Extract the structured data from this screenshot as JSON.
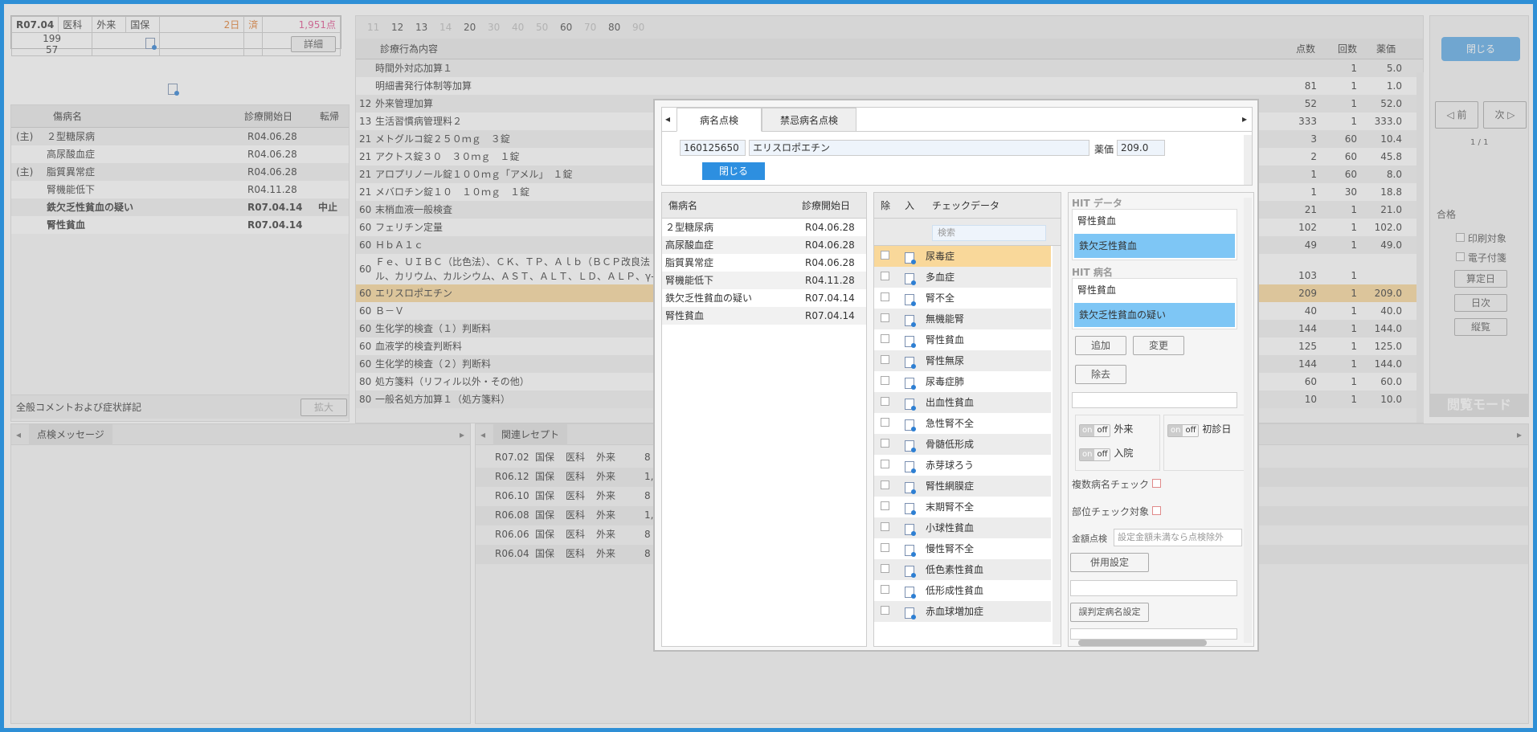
{
  "header": {
    "period": "R07.04",
    "dept": "医科",
    "visit": "外来",
    "insurer": "国保",
    "days": "2日",
    "done": "済",
    "points": "1,951点",
    "num1": "199",
    "num2": "57",
    "detail_btn": "詳細",
    "close_btn": "閉じる"
  },
  "diseases_left": {
    "col_name": "傷病名",
    "col_start": "診療開始日",
    "col_outcome": "転帰",
    "rows": [
      {
        "main": "(主)",
        "name": "２型糖尿病",
        "date": "R04.06.28",
        "outcome": ""
      },
      {
        "main": "",
        "name": "高尿酸血症",
        "date": "R04.06.28",
        "outcome": ""
      },
      {
        "main": "(主)",
        "name": "脂質異常症",
        "date": "R04.06.28",
        "outcome": ""
      },
      {
        "main": "",
        "name": "腎機能低下",
        "date": "R04.11.28",
        "outcome": ""
      },
      {
        "main": "",
        "name": "鉄欠乏性貧血の疑い",
        "date": "R07.04.14",
        "outcome": "中止"
      },
      {
        "main": "",
        "name": "腎性貧血",
        "date": "R07.04.14",
        "outcome": ""
      }
    ],
    "comment_label": "全般コメントおよび症状詳記",
    "expand_btn": "拡大"
  },
  "tabs_top": [
    "11",
    "12",
    "13",
    "14",
    "20",
    "30",
    "40",
    "50",
    "60",
    "70",
    "80",
    "90"
  ],
  "procedures": {
    "col_content": "診療行為内容",
    "col_points": "点数",
    "col_count": "回数",
    "col_drug": "薬価",
    "rows": [
      {
        "code": "",
        "name": "時間外対応加算１",
        "points": "",
        "count": "1",
        "drug": "5.0"
      },
      {
        "code": "",
        "name": "明細書発行体制等加算",
        "points": "81",
        "count": "1",
        "drug": "1.0"
      },
      {
        "code": "12",
        "name": "外来管理加算",
        "points": "52",
        "count": "1",
        "drug": "52.0"
      },
      {
        "code": "13",
        "name": "生活習慣病管理料２",
        "points": "333",
        "count": "1",
        "drug": "333.0"
      },
      {
        "code": "21",
        "name": "メトグルコ錠２５０ｍｇ　３錠",
        "points": "3",
        "count": "60",
        "drug": "10.4"
      },
      {
        "code": "21",
        "name": "アクトス錠３０　３０ｍｇ　１錠",
        "points": "2",
        "count": "60",
        "drug": "45.8"
      },
      {
        "code": "21",
        "name": "アロプリノール錠１００ｍｇ「アメル」　１錠",
        "points": "1",
        "count": "60",
        "drug": "8.0"
      },
      {
        "code": "21",
        "name": "メバロチン錠１０　１０ｍｇ　１錠",
        "points": "1",
        "count": "30",
        "drug": "18.8"
      },
      {
        "code": "60",
        "name": "末梢血液一般検査",
        "points": "21",
        "count": "1",
        "drug": "21.0"
      },
      {
        "code": "60",
        "name": "フェリチン定量",
        "points": "102",
        "count": "1",
        "drug": "102.0"
      },
      {
        "code": "60",
        "name": "ＨｂＡ１ｃ",
        "points": "49",
        "count": "1",
        "drug": "49.0"
      },
      {
        "code": "60",
        "name": "Ｆｅ、ＵＩＢＣ（比色法）、ＣＫ、ＴＰ、Ａｌｂ（ＢＣＰ改良法",
        "name2": "ル、カリウム、カルシウム、ＡＳＴ、ＡＬＴ、ＬＤ、ＡＬＰ、γ-",
        "points": "103",
        "count": "1",
        "drug": ""
      },
      {
        "code": "60",
        "name": "エリスロポエチン",
        "points": "209",
        "count": "1",
        "drug": "209.0"
      },
      {
        "code": "60",
        "name": "Ｂ－Ｖ",
        "points": "40",
        "count": "1",
        "drug": "40.0"
      },
      {
        "code": "60",
        "name": "生化学的検査（１）判断料",
        "points": "144",
        "count": "1",
        "drug": "144.0"
      },
      {
        "code": "60",
        "name": "血液学的検査判断料",
        "points": "125",
        "count": "1",
        "drug": "125.0"
      },
      {
        "code": "60",
        "name": "生化学的検査（２）判断料",
        "points": "144",
        "count": "1",
        "drug": "144.0"
      },
      {
        "code": "80",
        "name": "処方箋料（リフィル以外・その他）",
        "points": "60",
        "count": "1",
        "drug": "60.0"
      },
      {
        "code": "80",
        "name": "一般名処方加算１（処方箋料）",
        "points": "10",
        "count": "1",
        "drug": "10.0"
      }
    ]
  },
  "right_panel": {
    "prev_btn": "前",
    "next_btn": "次",
    "page": "1 / 1",
    "pass": "合格",
    "print_target": "印刷対象",
    "e_attach": "電子付箋",
    "calc_day": "算定日",
    "daily": "日次",
    "vertical": "縦覧",
    "mode": "閲覧モード"
  },
  "bottom_left": {
    "tab": "点検メッセージ"
  },
  "related": {
    "tab": "関連レセプト",
    "rows": [
      {
        "date": "R07.02",
        "ins": "国保",
        "dept": "医科",
        "visit": "外来",
        "pts": "8"
      },
      {
        "date": "R06.12",
        "ins": "国保",
        "dept": "医科",
        "visit": "外来",
        "pts": "1,1"
      },
      {
        "date": "R06.10",
        "ins": "国保",
        "dept": "医科",
        "visit": "外来",
        "pts": "8"
      },
      {
        "date": "R06.08",
        "ins": "国保",
        "dept": "医科",
        "visit": "外来",
        "pts": "1,5"
      },
      {
        "date": "R06.06",
        "ins": "国保",
        "dept": "医科",
        "visit": "外来",
        "pts": "8"
      },
      {
        "date": "R06.04",
        "ins": "国保",
        "dept": "医科",
        "visit": "外来",
        "pts": "8"
      }
    ]
  },
  "modal": {
    "tab1": "病名点検",
    "tab2": "禁忌病名点検",
    "code": "160125650",
    "drug_name": "エリスロポエチン",
    "price_label": "薬価",
    "price": "209.0",
    "close_btn": "閉じる",
    "col_name": "傷病名",
    "col_start": "診療開始日",
    "diseases": [
      {
        "name": "２型糖尿病",
        "date": "R04.06.28"
      },
      {
        "name": "高尿酸血症",
        "date": "R04.06.28"
      },
      {
        "name": "脂質異常症",
        "date": "R04.06.28"
      },
      {
        "name": "腎機能低下",
        "date": "R04.11.28"
      },
      {
        "name": "鉄欠乏性貧血の疑い",
        "date": "R07.04.14"
      },
      {
        "name": "腎性貧血",
        "date": "R07.04.14"
      }
    ],
    "col_exclude": "除",
    "col_in": "入",
    "col_check": "チェックデータ",
    "search_placeholder": "検索",
    "checks": [
      "尿毒症",
      "多血症",
      "腎不全",
      "無機能腎",
      "腎性貧血",
      "腎性無尿",
      "尿毒症肺",
      "出血性貧血",
      "急性腎不全",
      "骨髄低形成",
      "赤芽球ろう",
      "腎性網膜症",
      "末期腎不全",
      "小球性貧血",
      "慢性腎不全",
      "低色素性貧血",
      "低形成性貧血",
      "赤血球増加症"
    ],
    "hit_data_label": "HIT データ",
    "hit_data": [
      "腎性貧血",
      "鉄欠乏性貧血"
    ],
    "hit_name_label": "HIT 病名",
    "hit_names": [
      "腎性貧血",
      "鉄欠乏性貧血の疑い"
    ],
    "add_btn": "追加",
    "change_btn": "変更",
    "remove_btn": "除去",
    "outpatient": "外来",
    "inpatient": "入院",
    "first_day": "初診日",
    "on": "on",
    "off": "off",
    "multi_check": "複数病名チェック",
    "part_check": "部位チェック対象",
    "amount_label": "金額点検",
    "amount_placeholder": "設定金額未満なら点検除外",
    "combined": "併用設定",
    "misjudge": "誤判定病名設定"
  },
  "colors": {
    "accent": "#2e8fd6",
    "highlight_row": "#f9d89a",
    "hit_sel": "#7ec6f5"
  }
}
